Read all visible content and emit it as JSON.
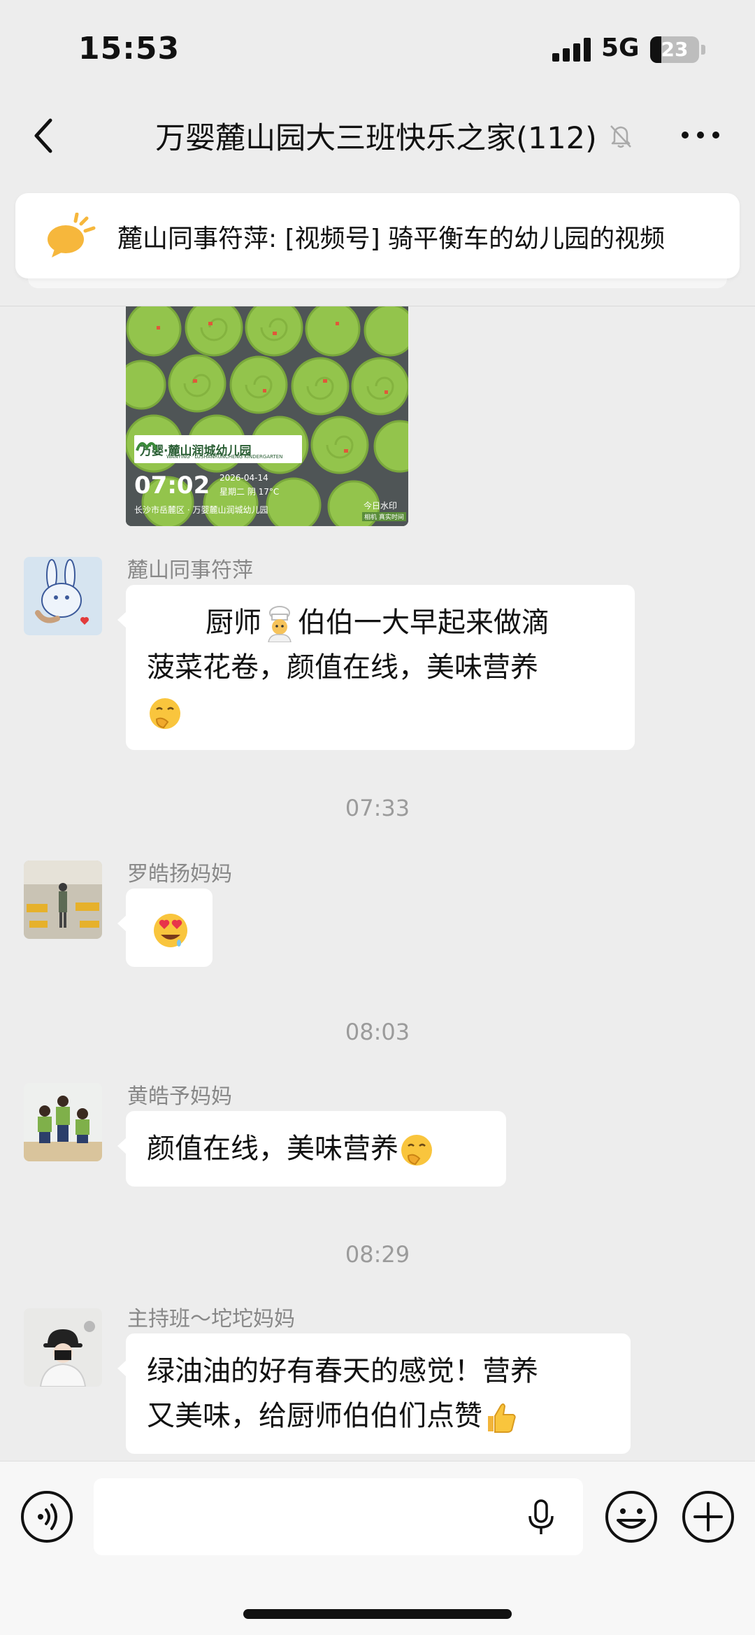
{
  "status_bar": {
    "time": "15:53",
    "network": "5G",
    "battery": "23",
    "battery_level": 0.23
  },
  "header": {
    "title": "万婴麓山园大三班快乐之家(112)",
    "back_icon": "chevron-left-icon",
    "mute_icon": "bell-off-icon",
    "more_icon": "more-dots-icon"
  },
  "pinned": {
    "icon": "speech-bubble-icon",
    "accent_color": "#f6b73c",
    "text": "麓山同事符萍: [视频号] 骑平衡车的幼儿园的视频"
  },
  "photo": {
    "logo_text": "万婴·麓山润城幼儿园",
    "logo_sub": "WANYING · LUSHANRUNCHENG KINDERGARTEN",
    "time": "07:02",
    "date": "2026-04-14",
    "weather": "星期二 阴 17°C",
    "location": "长沙市岳麓区 · 万婴麓山润城幼儿园",
    "brand": "今日水印",
    "tag": "相机 真实时间"
  },
  "messages": [
    {
      "sender": "麓山同事符萍",
      "line1_prefix": "厨师",
      "line1_suffix": "伯伯一大早起来做滴",
      "line2": "菠菜花卷，颜值在线，美味营养",
      "emoji_1": "chef-emoji",
      "emoji_2": "shushing-face-emoji"
    },
    {
      "time": "07:33",
      "sender": "罗皓扬妈妈",
      "emoji": "heart-eyes-drool-emoji"
    },
    {
      "time": "08:03",
      "sender": "黄皓予妈妈",
      "text": "颜值在线，美味营养",
      "emoji": "shushing-face-emoji"
    },
    {
      "time": "08:29",
      "sender": "主持班～坨坨妈妈",
      "line1": "绿油油的好有春天的感觉！营养",
      "line2": "又美味，给厨师伯伯们点赞",
      "emoji": "thumbs-up-emoji"
    }
  ],
  "input_bar": {
    "value": "",
    "voice_icon": "voice-icon",
    "mic_icon": "microphone-icon",
    "emoji_icon": "smiley-icon",
    "plus_icon": "plus-icon"
  }
}
